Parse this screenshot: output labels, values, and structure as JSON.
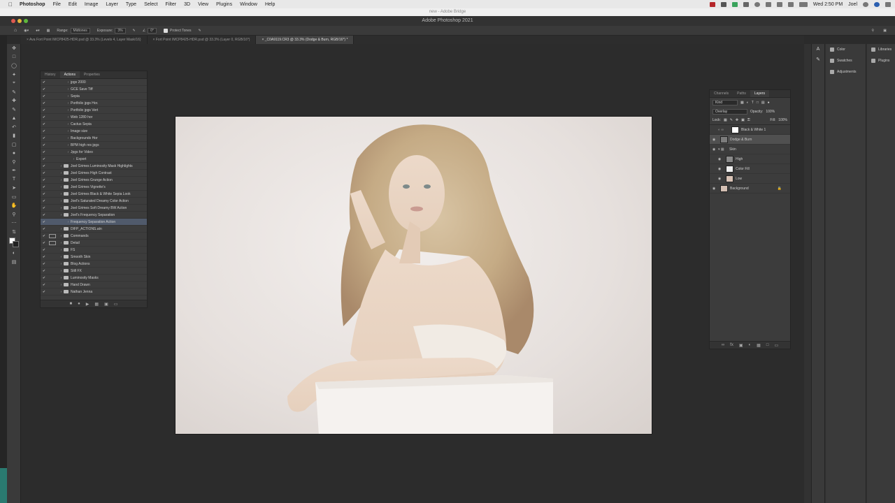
{
  "mac": {
    "app": "Photoshop",
    "menus": [
      "File",
      "Edit",
      "Image",
      "Layer",
      "Type",
      "Select",
      "Filter",
      "3D",
      "View",
      "Plugins",
      "Window",
      "Help"
    ],
    "clock": "Wed 2:50 PM",
    "user": "Joel"
  },
  "bridge_title": "new - Adobe Bridge",
  "window_title": "Adobe Photoshop 2021",
  "options": {
    "range_label": "Range:",
    "range_value": "Midtones",
    "exposure_label": "Exposure:",
    "exposure_value": "3%",
    "angle_value": "0°",
    "protect_label": "Protect Tones"
  },
  "tabs": [
    "Ava Fort Point IMCP8425-HDR.psd @ 33.3% (Levels 4, Layer Mask/16)",
    "Fort Point IMCP8425-HDR.psd @ 33.3% (Layer 0, RGB/16*)",
    "_C0A9119.CR3 @ 33.3% (Dodge & Burn, RGB/16*) *"
  ],
  "actions_panel": {
    "tabs": [
      "History",
      "Actions",
      "Properties"
    ],
    "items": [
      {
        "label": "jpgs 2000",
        "level": 2
      },
      {
        "label": "GCE Save Tiff",
        "level": 2
      },
      {
        "label": "Sepia",
        "level": 2
      },
      {
        "label": "Portfolio jpgs Hor.",
        "level": 2
      },
      {
        "label": "Portfolio jpgs Vert",
        "level": 2
      },
      {
        "label": "Web 1280 hor",
        "level": 2
      },
      {
        "label": "Cactus Sepia",
        "level": 2
      },
      {
        "label": "Image size",
        "level": 2
      },
      {
        "label": "Backgrounds Hor",
        "level": 2
      },
      {
        "label": "BPM high res jpgs",
        "level": 2
      },
      {
        "label": "Jpgs for Video",
        "level": 2
      },
      {
        "label": "Export",
        "level": 3
      },
      {
        "label": "Joel Grimes Luminosity Mask Highlights",
        "level": 1
      },
      {
        "label": "Joel Grimes High Contrast",
        "level": 1
      },
      {
        "label": "Joel Grimes Grunge Action",
        "level": 1
      },
      {
        "label": "Joel Grimes Vignette's",
        "level": 1
      },
      {
        "label": "Joel Grimes Black & White Sepia Look",
        "level": 1
      },
      {
        "label": "Joel's Saturated Dreamy Color Action",
        "level": 1
      },
      {
        "label": "Joel Grimes Soft Dreamy BW Action",
        "level": 1
      },
      {
        "label": "Joel's Frequency Separation",
        "level": 1
      },
      {
        "label": "Frequency Separation Action",
        "level": 2
      },
      {
        "label": "DIFP_ACTIONS.atn",
        "level": 1
      },
      {
        "label": "Commands",
        "level": 1
      },
      {
        "label": "Detail",
        "level": 1
      },
      {
        "label": "FS",
        "level": 1
      },
      {
        "label": "Smooth Skin",
        "level": 1
      },
      {
        "label": "Blog Actions",
        "level": 1
      },
      {
        "label": "Still FX",
        "level": 1
      },
      {
        "label": "Luminosity Masks",
        "level": 1
      },
      {
        "label": "Hand Drawn",
        "level": 1
      },
      {
        "label": "Nathan Jenna",
        "level": 1
      }
    ]
  },
  "layers_panel": {
    "tabs": [
      "Channels",
      "Paths",
      "Layers"
    ],
    "filter_label": "Kind",
    "blend_mode": "Overlay",
    "opacity_label": "Opacity:",
    "opacity_value": "100%",
    "lock_label": "Lock:",
    "fill_label": "Fill:",
    "fill_value": "100%",
    "layers": [
      {
        "name": "Black & White 1"
      },
      {
        "name": "Dodge & Burn"
      },
      {
        "name": "Skin"
      },
      {
        "name": "High"
      },
      {
        "name": "Color Fill"
      },
      {
        "name": "Low"
      },
      {
        "name": "Background"
      }
    ]
  },
  "dock": {
    "items": [
      "Color",
      "Swatches",
      "Adjustments"
    ],
    "items2": [
      "Libraries",
      "Plugins"
    ]
  },
  "colors": {
    "accent": "#2a7a70",
    "selection": "#505a6b"
  }
}
